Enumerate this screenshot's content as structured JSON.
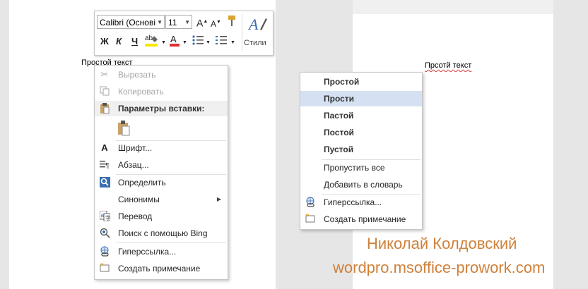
{
  "left_doc": {
    "text": "Простой текст"
  },
  "right_doc": {
    "text": "Прсотй текст"
  },
  "mini_toolbar": {
    "font_name": "Calibri (Основі",
    "font_size": "11",
    "bold": "Ж",
    "italic": "К",
    "underline": "Ч",
    "highlight_color": "#f5e800",
    "font_color": "#e03030",
    "styles_label": "Стили"
  },
  "context_menu": {
    "items": [
      {
        "label": "Вырезать",
        "icon": "scissors-icon",
        "disabled": true
      },
      {
        "label": "Копировать",
        "icon": "copy-icon",
        "disabled": true
      },
      {
        "label": "Параметры вставки:",
        "icon": "paste-icon",
        "header": true
      },
      {
        "label": "Шрифт...",
        "icon": "font-icon"
      },
      {
        "label": "Абзац...",
        "icon": "paragraph-icon"
      },
      {
        "label": "Определить",
        "icon": "define-icon"
      },
      {
        "label": "Синонимы",
        "icon": "",
        "submenu": true
      },
      {
        "label": "Перевод",
        "icon": "translate-icon"
      },
      {
        "label": "Поиск с помощью Bing",
        "icon": "search-icon"
      },
      {
        "label": "Гиперссылка...",
        "icon": "hyperlink-icon"
      },
      {
        "label": "Создать примечание",
        "icon": "comment-icon"
      }
    ]
  },
  "spell_menu": {
    "suggestions": [
      "Простой",
      "Прости",
      "Пастой",
      "Постой",
      "Пустой"
    ],
    "highlighted_index": 1,
    "actions": [
      "Пропустить все",
      "Добавить в словарь"
    ],
    "more": [
      {
        "label": "Гиперссылка...",
        "icon": "hyperlink-icon"
      },
      {
        "label": "Создать примечание",
        "icon": "comment-icon"
      }
    ]
  },
  "watermark": {
    "author": "Николай Колдовский",
    "site": "wordpro.msoffice-prowork.com"
  }
}
